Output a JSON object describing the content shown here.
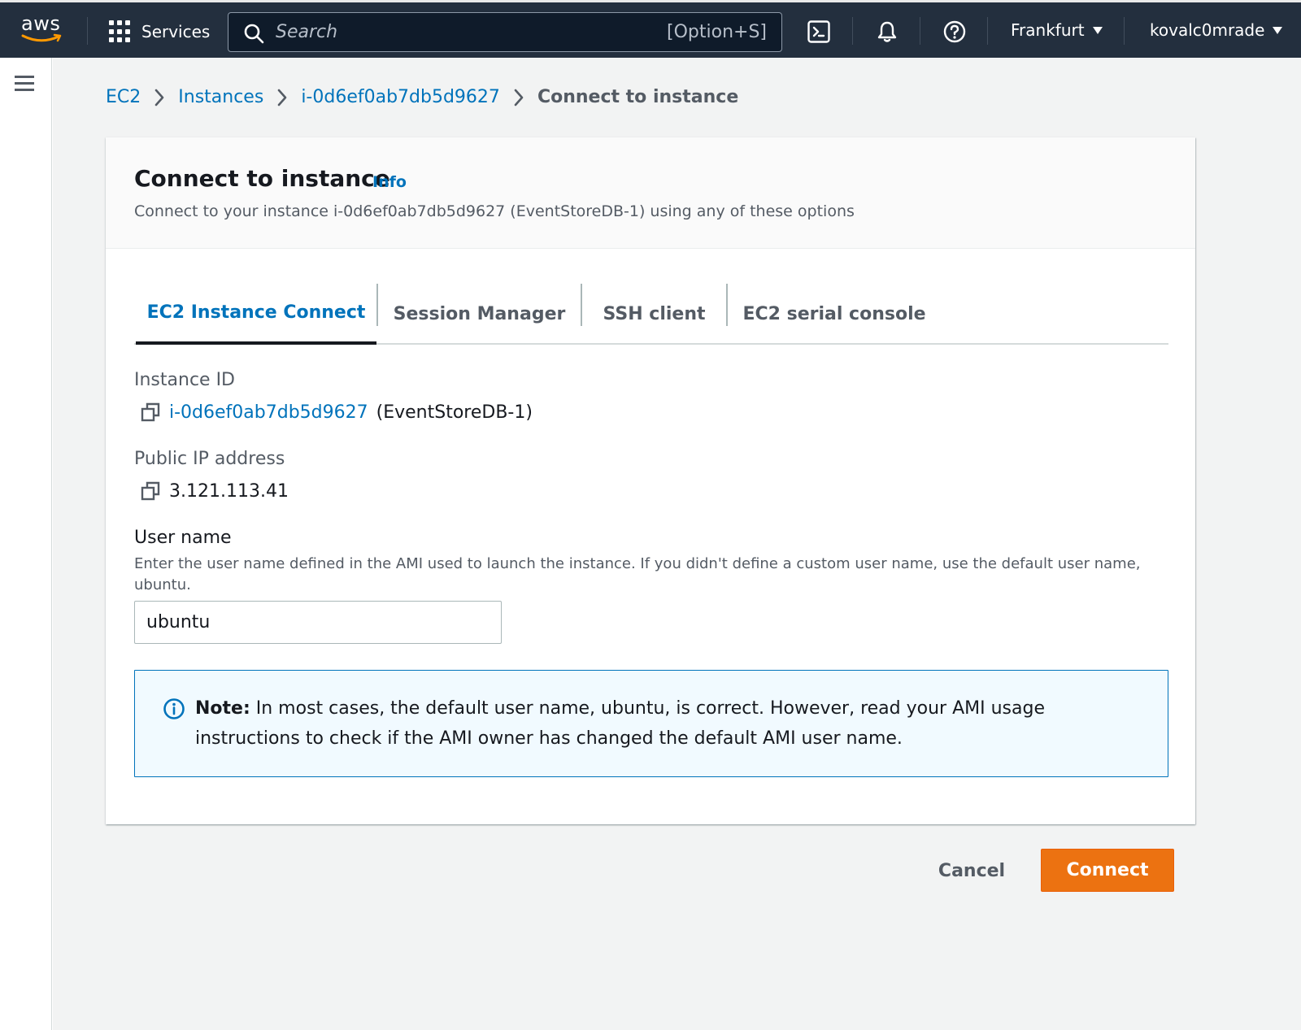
{
  "topnav": {
    "logo_text": "aws",
    "services_label": "Services",
    "search": {
      "placeholder": "Search",
      "shortcut": "[Option+S]"
    },
    "icons": [
      "cloudshell-icon",
      "bell-icon",
      "help-icon"
    ],
    "region": "Frankfurt",
    "account": "kovalc0mrade"
  },
  "breadcrumb": {
    "items": [
      "EC2",
      "Instances",
      "i-0d6ef0ab7db5d9627"
    ],
    "current": "Connect to instance"
  },
  "card": {
    "title": "Connect to instance",
    "info_link": "Info",
    "subtitle": "Connect to your instance i-0d6ef0ab7db5d9627 (EventStoreDB-1) using any of these options"
  },
  "tabs": [
    {
      "label": "EC2 Instance Connect",
      "active": true
    },
    {
      "label": "Session Manager",
      "active": false
    },
    {
      "label": "SSH client",
      "active": false
    },
    {
      "label": "EC2 serial console",
      "active": false
    }
  ],
  "fields": {
    "instance_id_label": "Instance ID",
    "instance_id_value": "i-0d6ef0ab7db5d9627",
    "instance_name": "(EventStoreDB-1)",
    "public_ip_label": "Public IP address",
    "public_ip_value": "3.121.113.41",
    "user_name_label": "User name",
    "user_name_help": "Enter the user name defined in the AMI used to launch the instance. If you didn't define a custom user name, use the default user name, ubuntu.",
    "user_name_value": "ubuntu"
  },
  "alert": {
    "prefix": "Note:",
    "text": " In most cases, the default user name, ubuntu, is correct. However, read your AMI usage instructions to check if the AMI owner has changed the default AMI user name."
  },
  "actions": {
    "cancel": "Cancel",
    "connect": "Connect"
  },
  "colors": {
    "nav_bg": "#232f3e",
    "link": "#0073bb",
    "primary_button": "#ec7211",
    "alert_bg": "#f1faff"
  }
}
